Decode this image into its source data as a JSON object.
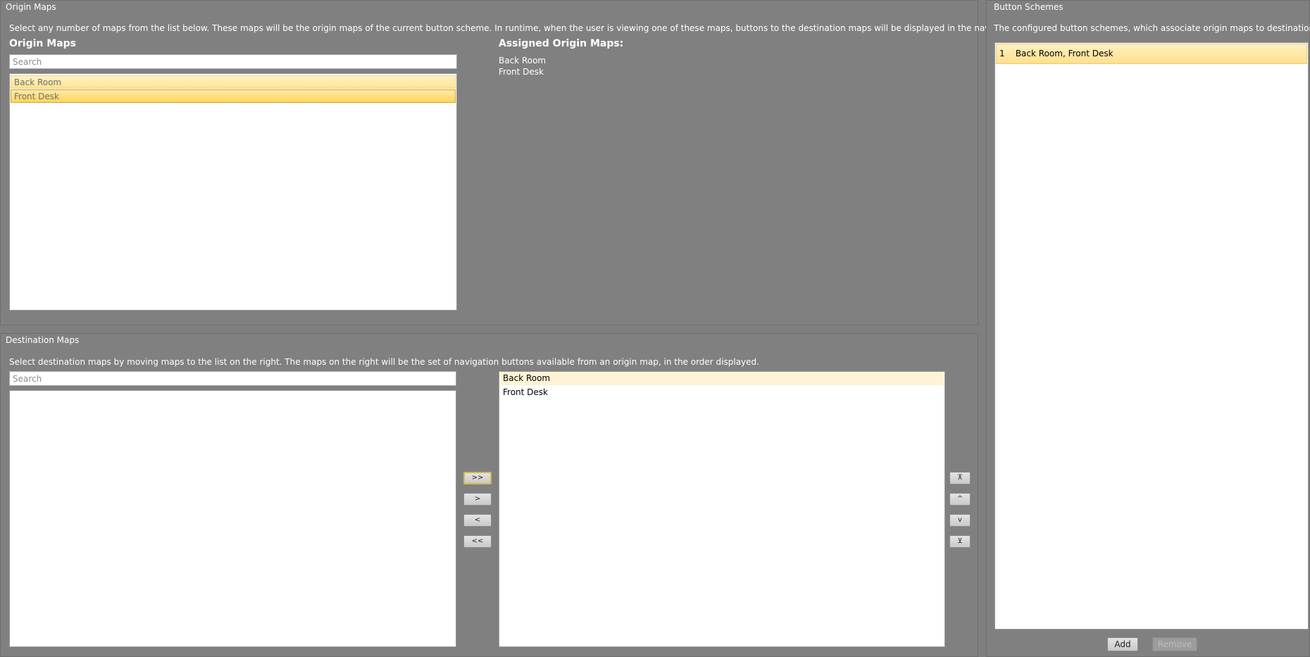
{
  "origin": {
    "title": "Origin Maps",
    "description": "Select any number of maps from the list below. These maps will be the origin maps of the current button scheme. In runtime, when the user is viewing one of these maps, buttons to the destination maps will be displayed in the navigation item.",
    "list_heading": "Origin Maps",
    "search_placeholder": "Search",
    "items": [
      "Back Room",
      "Front Desk"
    ],
    "assigned_heading": "Assigned Origin Maps:",
    "assigned": [
      "Back Room",
      "Front Desk"
    ]
  },
  "destination": {
    "title": "Destination Maps",
    "description": "Select destination maps by moving maps to the list on the right. The maps on the right will be the set of navigation buttons available from an origin map, in the order displayed.",
    "search_placeholder": "Search",
    "available": [],
    "selected": [
      "Back Room",
      "Front Desk"
    ],
    "move_buttons": {
      "move_all_right": ">>",
      "move_right": ">",
      "move_left": "<",
      "move_all_left": "<<"
    },
    "order_buttons": {
      "move_top": "⊼",
      "move_up": "^",
      "move_down": "v",
      "move_bottom": "⊻"
    }
  },
  "schemes": {
    "title": "Button Schemes",
    "description": "The configured button schemes, which associate origin maps to destination maps.",
    "items": [
      {
        "index": "1",
        "label": "Back Room, Front Desk"
      }
    ],
    "add_label": "Add",
    "remove_label": "Remove"
  },
  "colors": {
    "background": "#808080",
    "selection_highlight": "#ffe08c",
    "list_background": "#ffffff"
  }
}
